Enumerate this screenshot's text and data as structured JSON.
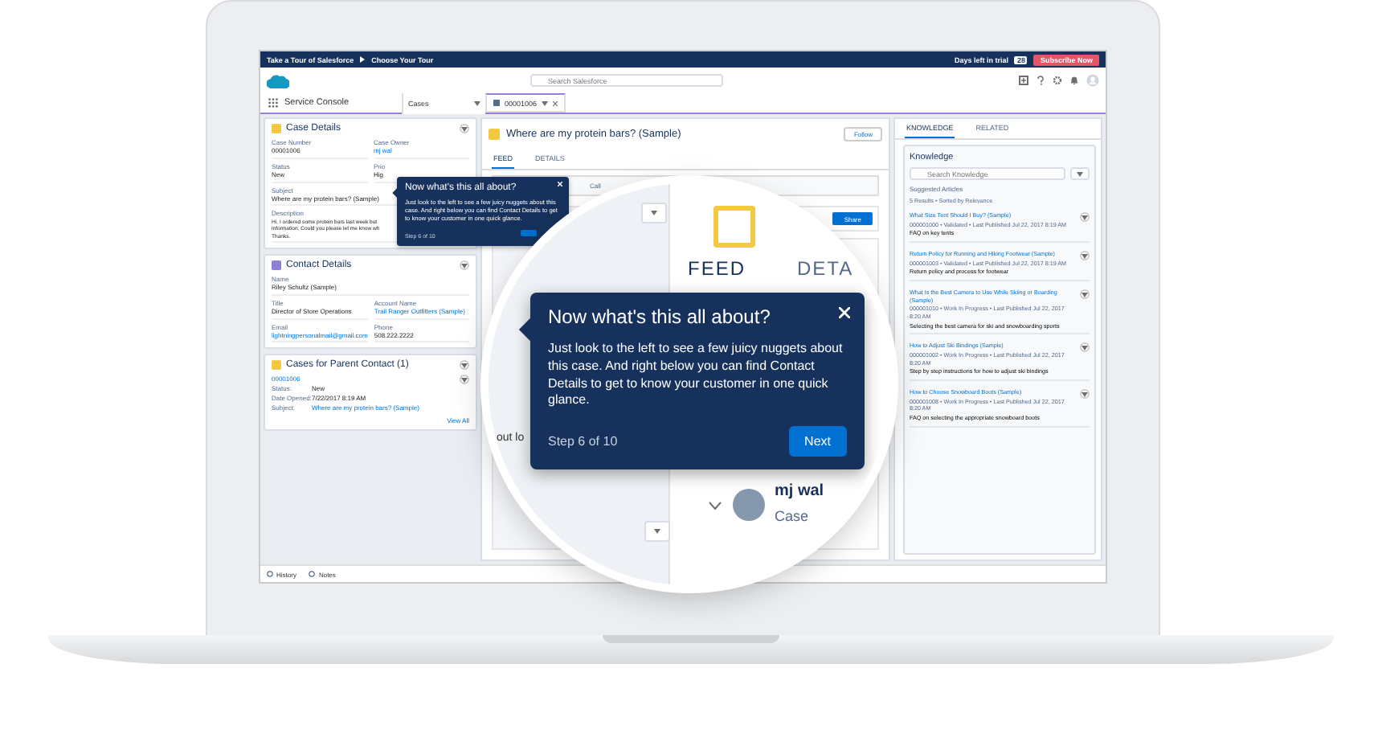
{
  "top_bar": {
    "breadcrumbs": [
      "Take a Tour of Salesforce",
      "Choose Your Tour"
    ],
    "trial_label": "Days left in trial",
    "trial_days": "28",
    "subscribe_button": "Subscribe Now"
  },
  "header": {
    "search_placeholder": "Search Salesforce"
  },
  "nav": {
    "app_name": "Service Console",
    "object_select": "Cases",
    "tabs": [
      {
        "label": "00001006",
        "selected": true
      }
    ]
  },
  "case_details": {
    "title": "Case Details",
    "fields": [
      {
        "label": "Case Number",
        "value": "00001006",
        "kind": "text"
      },
      {
        "label": "Case Owner",
        "value": "mj wal",
        "kind": "link"
      },
      {
        "label": "Status",
        "value": "New",
        "kind": "text"
      },
      {
        "label": "Prio",
        "value": "Hig",
        "kind": "text"
      },
      {
        "label": "Subject",
        "value": "Where are my protein bars? (Sample)",
        "kind": "wide"
      },
      {
        "label": "Description",
        "lines": [
          "Hi, I ordered some protein bars last week but",
          "information. Could you please let me know wh",
          "Thanks."
        ],
        "kind": "multiline"
      }
    ]
  },
  "contact_details": {
    "title": "Contact Details",
    "fields": [
      {
        "label": "Name",
        "value": "Riley Schultz (Sample)",
        "kind": "wide"
      },
      {
        "label": "Title",
        "value": "Director of Store Operations",
        "kind": "text"
      },
      {
        "label": "Account Name",
        "value": "Trail Ranger Outfitters (Sample)",
        "kind": "link"
      },
      {
        "label": "Email",
        "value": "lightningpersonalmail@gmail.com",
        "kind": "link"
      },
      {
        "label": "Phone",
        "value": "508.222.2222",
        "kind": "text"
      }
    ]
  },
  "parent_cases": {
    "title": "Cases for Parent Contact (1)",
    "case_number": "00001006",
    "rows": [
      {
        "label": "Status:",
        "value": "New",
        "kind": "text"
      },
      {
        "label": "Date Opened:",
        "value": "7/22/2017 8:19 AM",
        "kind": "text"
      },
      {
        "label": "Subject:",
        "value": "Where are my protein bars? (Sample)",
        "kind": "link"
      }
    ],
    "view_all": "View All"
  },
  "footer": {
    "items": [
      "History",
      "Notes"
    ]
  },
  "center": {
    "title": "Where are my protein bars? (Sample)",
    "follow_button": "Follow",
    "tabs": [
      {
        "label": "FEED",
        "selected": true
      },
      {
        "label": "DETAILS",
        "selected": false
      }
    ],
    "publisher_action": "Call",
    "share_button": "Share"
  },
  "popover_small": {
    "title": "Now what's this all about?",
    "body": "Just look to the left to see a few juicy nuggets about this case. And right below you can find Contact Details to get to know your customer in one quick glance.",
    "step": "Step 6 of 10"
  },
  "popover": {
    "title": "Now what's this all about?",
    "body": "Just look to the left to see a few juicy nuggets about this case. And right below you can find Contact Details to get to know your customer in one quick glance.",
    "step": "Step 6 of 10",
    "next_button": "Next"
  },
  "magnifier": {
    "tabs": [
      {
        "label": "FEED",
        "selected": true
      },
      {
        "label": "DETA",
        "selected": false
      }
    ],
    "fragment": "out lo",
    "author": "mj wal",
    "author_subtitle": "Case"
  },
  "right": {
    "tabs": [
      {
        "label": "KNOWLEDGE",
        "selected": true
      },
      {
        "label": "RELATED",
        "selected": false
      }
    ],
    "title": "Knowledge",
    "search_placeholder": "Search Knowledge",
    "subtitle": "Suggested Articles",
    "results": "5 Results • Sorted by Relevance",
    "articles": [
      {
        "title": "What Size Tent Should I Buy? (Sample)",
        "meta": "000001000 • Validated • Last Published Jul 22, 2017 8:19 AM",
        "summary": "FAQ on key tents"
      },
      {
        "title": "Return Policy for Running and Hiking Footwear (Sample)",
        "meta": "000001003 • Validated • Last Published Jul 22, 2017 8:19 AM",
        "summary": "Return policy and process for footwear"
      },
      {
        "title": "What Is the Best Camera to Use While Skiing or Boarding (Sample)",
        "meta": "000001010 • Work In Progress • Last Published Jul 22, 2017 8:20 AM",
        "summary": "Selecting the best camera for ski and snowboarding sports"
      },
      {
        "title": "How to Adjust Ski Bindings (Sample)",
        "meta": "000001002 • Work In Progress • Last Published Jul 22, 2017 8:20 AM",
        "summary": "Step by step instructions for how to adjust ski bindings"
      },
      {
        "title": "How to Choose Snowboard Boots (Sample)",
        "meta": "000001008 • Work In Progress • Last Published Jul 22, 2017 8:20 AM",
        "summary": "FAQ on selecting the appropriate snowboard boots"
      }
    ]
  }
}
